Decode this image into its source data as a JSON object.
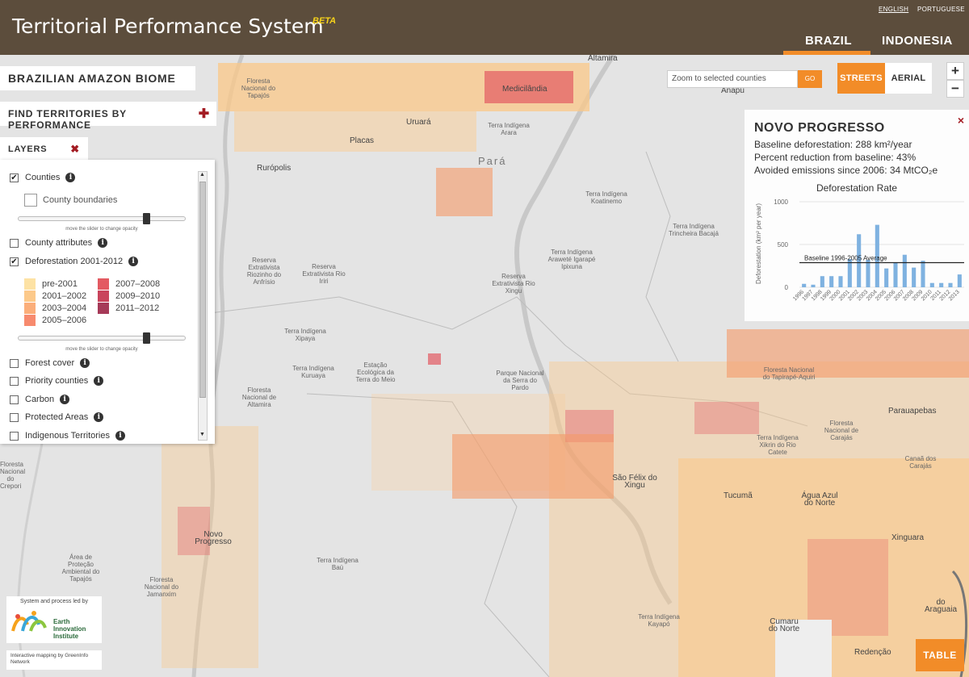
{
  "header": {
    "title": "Territorial Performance System",
    "beta": "BETA",
    "lang_english": "ENGLISH",
    "lang_portuguese": "PORTUGUESE",
    "tab_brazil": "BRAZIL",
    "tab_indonesia": "INDONESIA",
    "active_color": "#f28c28",
    "bg_color": "#5c4d3c"
  },
  "region_title": "BRAZILIAN AMAZON BIOME",
  "find_button": "FIND TERRITORIES BY PERFORMANCE",
  "layers": {
    "heading": "LAYERS",
    "items": [
      {
        "label": "Counties",
        "checked": true
      },
      {
        "label": "County attributes",
        "checked": false
      },
      {
        "label": "Deforestation 2001-2012",
        "checked": true
      },
      {
        "label": "Forest cover",
        "checked": false
      },
      {
        "label": "Priority counties",
        "checked": false
      },
      {
        "label": "Carbon",
        "checked": false
      },
      {
        "label": "Protected Areas",
        "checked": false
      },
      {
        "label": "Indigenous Territories",
        "checked": false
      }
    ],
    "sub_item": "County boundaries",
    "slider_note": "move the slider to change opacity",
    "legend": [
      {
        "label": "pre-2001",
        "color": "#fde2a4"
      },
      {
        "label": "2001–2002",
        "color": "#fcc98a"
      },
      {
        "label": "2003–2004",
        "color": "#fbae7a"
      },
      {
        "label": "2005–2006",
        "color": "#f78a6e"
      },
      {
        "label": "2007–2008",
        "color": "#e35a62"
      },
      {
        "label": "2009–2010",
        "color": "#c9445c"
      },
      {
        "label": "2011–2012",
        "color": "#a63a58"
      }
    ]
  },
  "search": {
    "placeholder": "Zoom to selected counties",
    "go": "GO"
  },
  "map_toggle": {
    "streets": "STREETS",
    "aerial": "AERIAL"
  },
  "zoom": {
    "in": "+",
    "out": "−"
  },
  "popup": {
    "title": "NOVO PROGRESSO",
    "baseline": "Baseline deforestation: 288 km²/year",
    "reduction": "Percent reduction from baseline: 43%",
    "emissions": "Avoided emissions since 2006: 34 MtCO₂e",
    "close": "×"
  },
  "chart_data": {
    "type": "bar",
    "title": "Deforestation Rate",
    "ylabel": "Deforestation (km² per year)",
    "xlabel": "",
    "ylim": [
      0,
      1000
    ],
    "yticks": [
      0,
      500,
      1000
    ],
    "categories": [
      "1996",
      "1997",
      "1998",
      "1999",
      "2000",
      "2001",
      "2002",
      "2003",
      "2004",
      "2005",
      "2006",
      "2007",
      "2008",
      "2009",
      "2010",
      "2011",
      "2012",
      "2013"
    ],
    "values": [
      40,
      30,
      130,
      130,
      130,
      330,
      620,
      320,
      730,
      220,
      290,
      380,
      230,
      310,
      50,
      50,
      50,
      150
    ],
    "reference_line": {
      "label": "Baseline 1996-2005 Average",
      "value": 288
    },
    "bar_color": "#7fb2e0"
  },
  "map_labels": {
    "state": "Pará",
    "places": [
      "Floresta Nacional do Tapajós",
      "Altamira",
      "Medicilândia",
      "Anapu",
      "Uruará",
      "Terra Indígena Arara",
      "Placas",
      "Rurópolis",
      "Terra Indígena Koatinemo",
      "Terra Indígena Trincheira Bacajá",
      "Terra Indígena Araweté Igarapé Ipixuna",
      "Reserva Extrativista Riozinho do Anfrísio",
      "Reserva Extrativista Rio Iriri",
      "Reserva Extrativista Rio Xingu",
      "Terra Indígena Xipaya",
      "Terra Indígena Kuruaya",
      "Estação Ecológica da Terra do Meio",
      "Parque Nacional da Serra do Pardo",
      "Floresta Nacional de Altamira",
      "Floresta Nacional do Tapirapé-Aquiri",
      "Parauapebas",
      "Floresta Nacional de Carajás",
      "Terra Indígena Xikrin do Rio Catete",
      "Canaã dos Carajás",
      "São Félix do Xingu",
      "Tucumã",
      "Água Azul do Norte",
      "Xinguara",
      "Novo Progresso",
      "Área de Proteção Ambiental do Tapajós",
      "Floresta Nacional do Jamanxim",
      "Terra Indígena Baú",
      "Terra Indígena Kayapó",
      "Cumaru do Norte",
      "Redenção",
      "do Araguaia",
      "Floresta Nacional do Crepori"
    ]
  },
  "credits": {
    "led_by": "System and process led by",
    "org": "Earth Innovation Institute",
    "mapping": "Interactive mapping by GreenInfo Network"
  },
  "table_button": "TABLE"
}
